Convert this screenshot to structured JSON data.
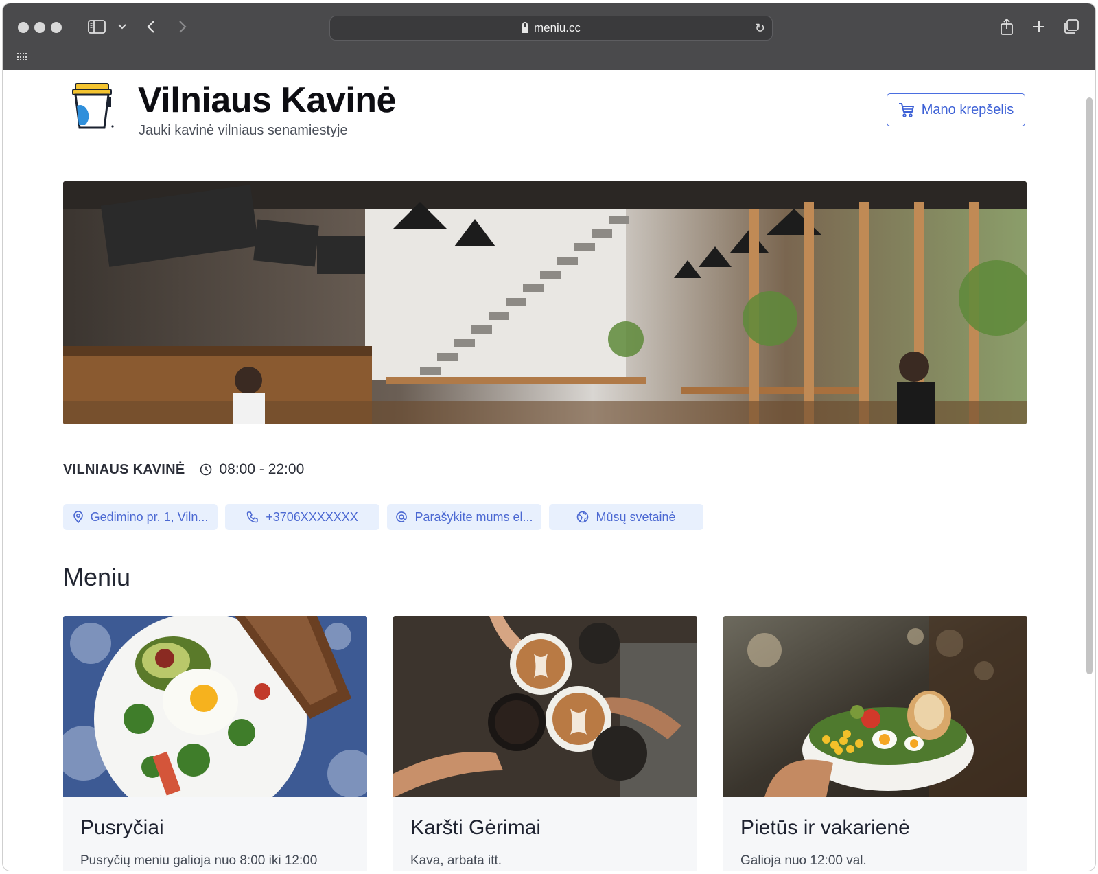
{
  "browser": {
    "url": "meniu.cc"
  },
  "header": {
    "title": "Vilniaus Kavinė",
    "subtitle": "Jauki kavinė vilniaus senamiestyje",
    "cart_label": "Mano krepšelis"
  },
  "info": {
    "name": "VILNIAUS KAVINĖ",
    "hours": "08:00 - 22:00",
    "chips": [
      {
        "label": "Gedimino pr. 1, Viln...",
        "icon": "map-pin-icon"
      },
      {
        "label": "+3706XXXXXXX",
        "icon": "phone-icon"
      },
      {
        "label": "Parašykite mums el...",
        "icon": "at-icon"
      },
      {
        "label": "Mūsų svetainė",
        "icon": "globe-icon"
      }
    ]
  },
  "menu": {
    "title": "Meniu",
    "cards": [
      {
        "title": "Pusryčiai",
        "description": "Pusryčių meniu galioja nuo 8:00 iki 12:00"
      },
      {
        "title": "Karšti Gėrimai",
        "description": "Kava, arbata itt."
      },
      {
        "title": "Pietūs ir vakarienė",
        "description": "Galioja nuo 12:00 val."
      }
    ]
  },
  "colors": {
    "accent": "#3d61d6",
    "chip_bg": "#e8f0fd",
    "chrome": "#4a4a4c"
  }
}
